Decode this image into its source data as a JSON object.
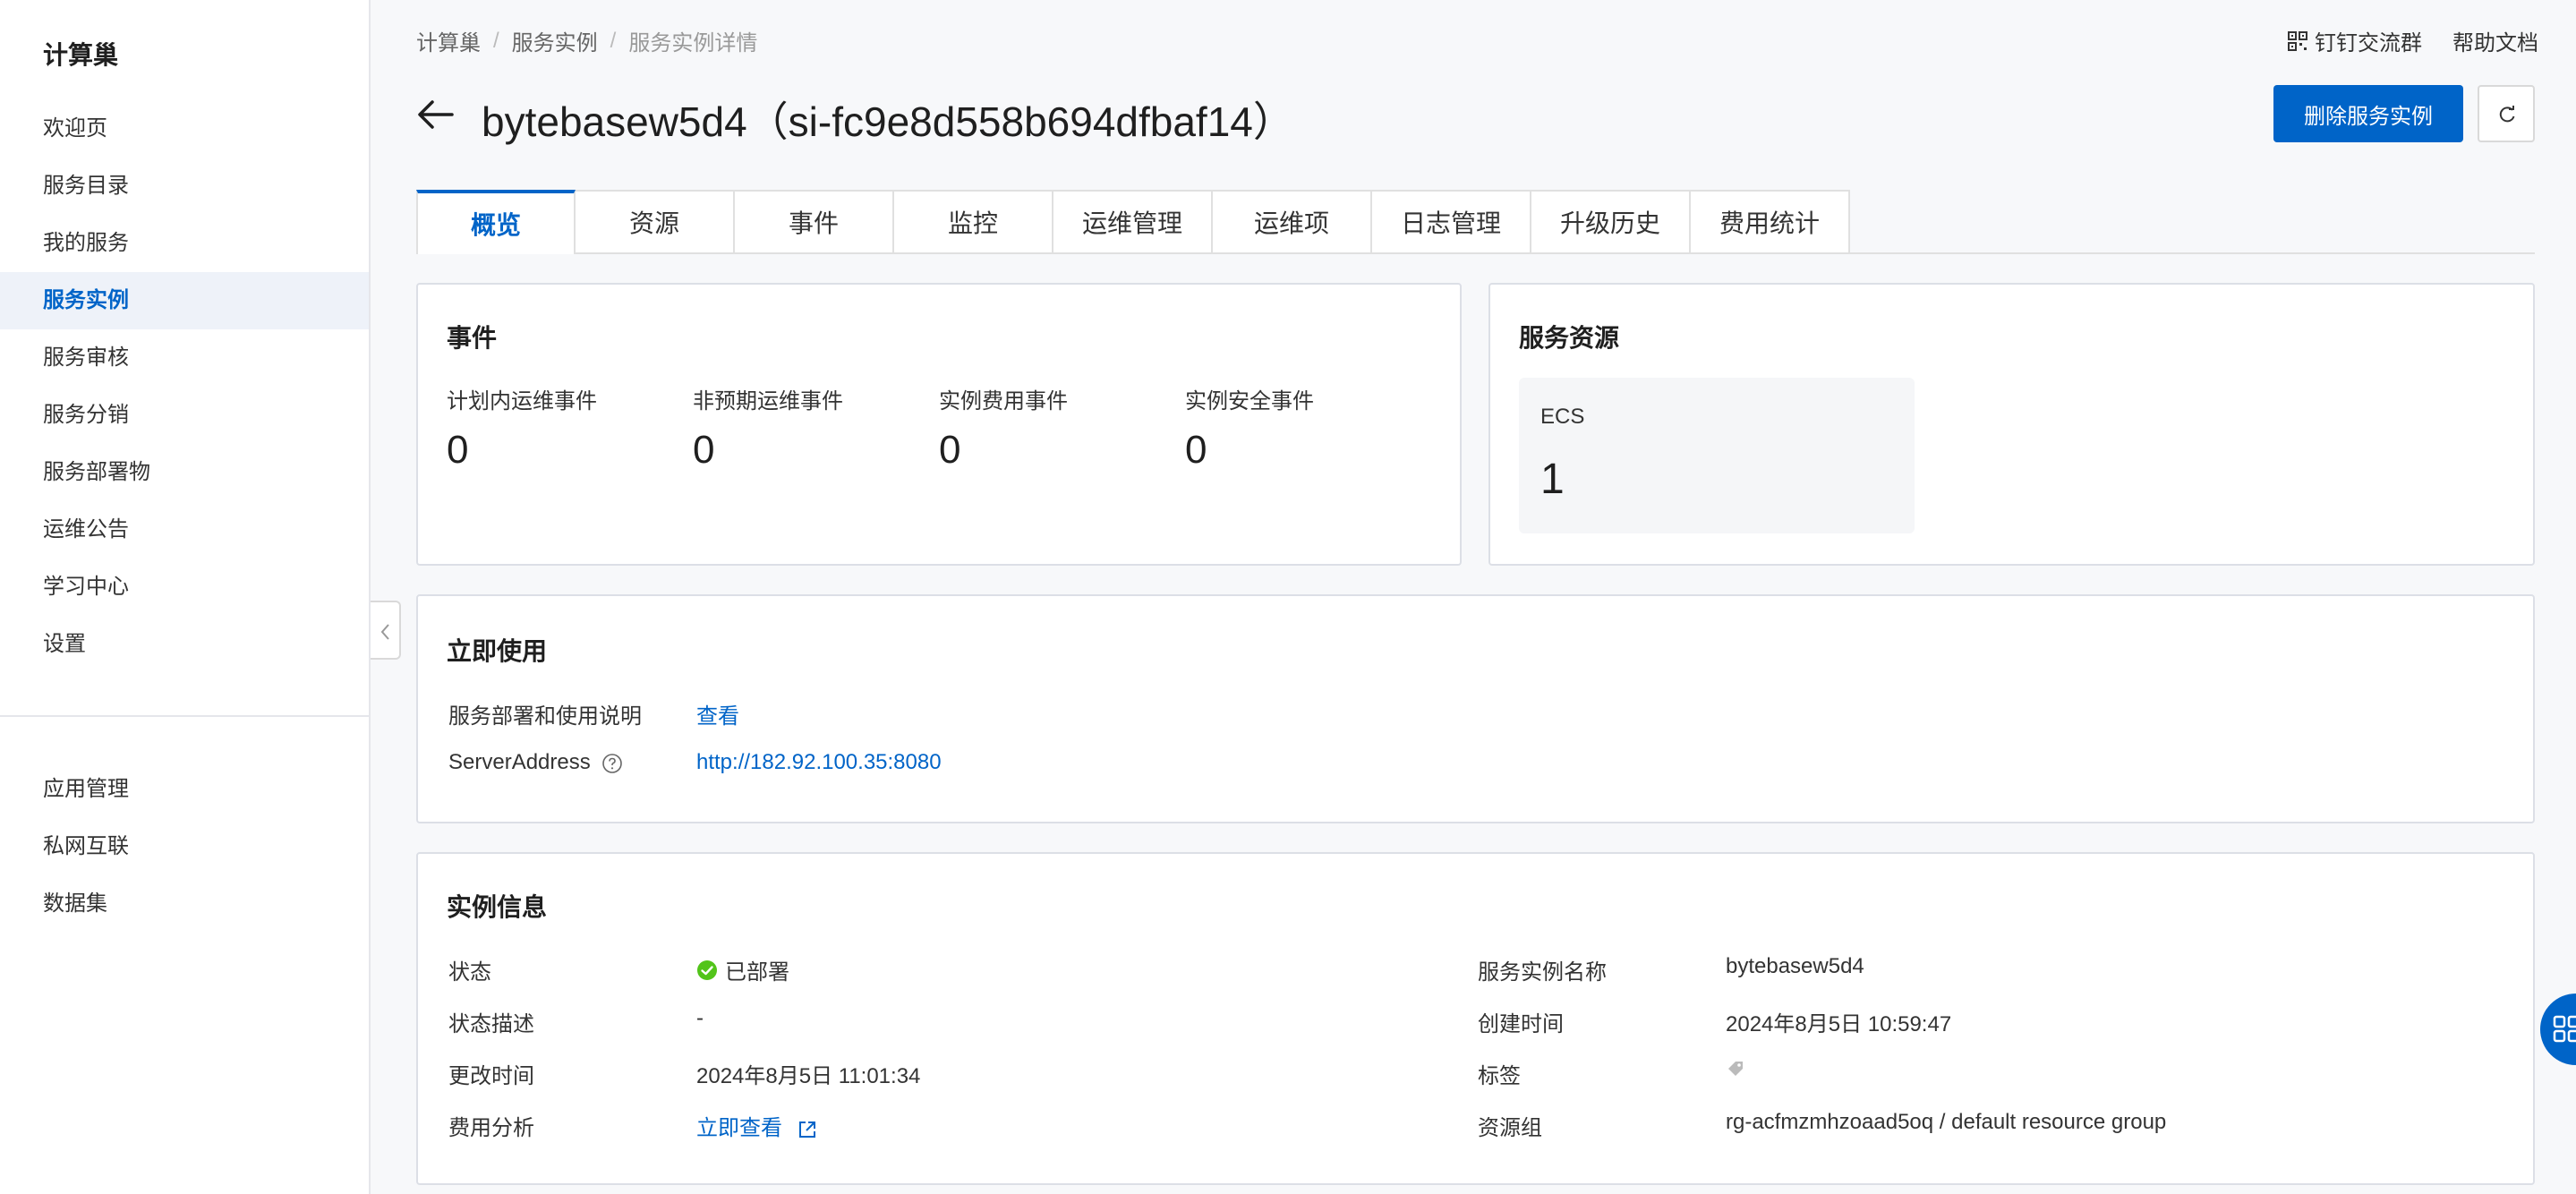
{
  "sidebar": {
    "title": "计算巢",
    "items": [
      {
        "label": "欢迎页"
      },
      {
        "label": "服务目录"
      },
      {
        "label": "我的服务"
      },
      {
        "label": "服务实例"
      },
      {
        "label": "服务审核"
      },
      {
        "label": "服务分销"
      },
      {
        "label": "服务部署物"
      },
      {
        "label": "运维公告"
      },
      {
        "label": "学习中心"
      },
      {
        "label": "设置"
      }
    ],
    "items2": [
      {
        "label": "应用管理"
      },
      {
        "label": "私网互联"
      },
      {
        "label": "数据集"
      }
    ],
    "active_item": "服务实例"
  },
  "breadcrumb": [
    "计算巢",
    "服务实例",
    "服务实例详情"
  ],
  "breadcrumb_sep": "/",
  "top_links": {
    "dingtalk": "钉钉交流群",
    "help": "帮助文档"
  },
  "header": {
    "title": "bytebasew5d4（si-fc9e8d558b694dfbaf14）",
    "delete_label": "删除服务实例"
  },
  "tabs": [
    {
      "label": "概览"
    },
    {
      "label": "资源"
    },
    {
      "label": "事件"
    },
    {
      "label": "监控"
    },
    {
      "label": "运维管理"
    },
    {
      "label": "运维项"
    },
    {
      "label": "日志管理"
    },
    {
      "label": "升级历史"
    },
    {
      "label": "费用统计"
    }
  ],
  "active_tab": "概览",
  "events": {
    "title": "事件",
    "stats": [
      {
        "label": "计划内运维事件",
        "value": "0"
      },
      {
        "label": "非预期运维事件",
        "value": "0"
      },
      {
        "label": "实例费用事件",
        "value": "0"
      },
      {
        "label": "实例安全事件",
        "value": "0"
      }
    ]
  },
  "resources": {
    "title": "服务资源",
    "ecs_label": "ECS",
    "ecs_value": "1"
  },
  "usage": {
    "title": "立即使用",
    "doc_label": "服务部署和使用说明",
    "doc_link": "查看",
    "server_label": "ServerAddress",
    "server_value": "http://182.92.100.35:8080"
  },
  "instance": {
    "title": "实例信息",
    "status_label": "状态",
    "status_value": "已部署",
    "status_desc_label": "状态描述",
    "status_desc_value": "-",
    "modified_label": "更改时间",
    "modified_value": "2024年8月5日 11:01:34",
    "cost_label": "费用分析",
    "cost_link": "立即查看",
    "name_label": "服务实例名称",
    "name_value": "bytebasew5d4",
    "created_label": "创建时间",
    "created_value": "2024年8月5日 10:59:47",
    "tags_label": "标签",
    "group_label": "资源组",
    "group_value": "rg-acfmzmhzoaad5oq / default resource group"
  },
  "colors": {
    "accent": "#0064c8",
    "success": "#52c41a"
  }
}
